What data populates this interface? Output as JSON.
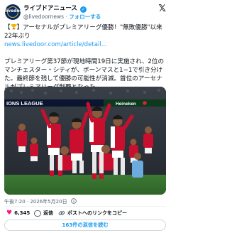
{
  "account": {
    "name": "ライブドアニュース",
    "handle": "@livedoornews",
    "follow_label": "フォローする",
    "avatar_text": "livedoor"
  },
  "brand_icon": "x-logo-icon",
  "tweet": {
    "headline": "アーセナルがプレミアリーグ優勝！\"無敗優勝\"以来22年ぶり",
    "headline_prefix": "【",
    "headline_suffix": "】",
    "link": "news.livedoor.com/article/detail...",
    "body": "プレミアリーグ第37節が現地時間19日に実施され、2位のマンチェスター・シティが、ボーンマスと1−1で引き分けた。最終節を残して優勝の可能性が消滅。首位のアーセナルがプレミアリーグ制覇となった。"
  },
  "photo": {
    "banner_left": "IONS LEAGUE",
    "banner_right": "Heineken"
  },
  "timestamp": "午後7:20 · 2026年5月20日",
  "info_icon": "info-icon",
  "actions": {
    "like_count": "6,345",
    "reply_label": "返信",
    "copy_link_label": "ポストへのリンクをコピー"
  },
  "replies_button": "163件の返信を読む",
  "colors": {
    "accent": "#1d9bf0",
    "like": "#f91880",
    "text": "#0f1419",
    "muted": "#536471"
  }
}
